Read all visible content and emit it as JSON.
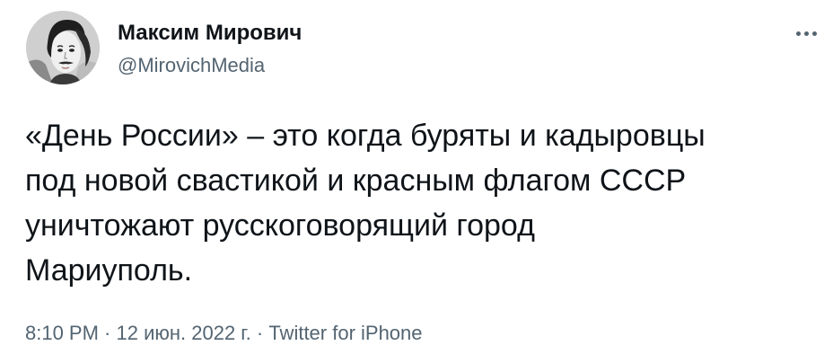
{
  "author": {
    "display_name": "Максим Мирович",
    "handle": "@MirovichMedia",
    "avatar_icon": "profile-photo"
  },
  "more_icon": "more-horizontal-icon",
  "tweet": {
    "lines": [
      "«День России» – это когда буряты и кадыровцы",
      "под новой свастикой и красным флагом СССР",
      "уничтожают русскоговорящий город",
      "Мариуполь."
    ]
  },
  "meta": {
    "time": "8:10 PM",
    "separator1": " · ",
    "date": "12 июн. 2022 г.",
    "separator2": " · ",
    "source": "Twitter for iPhone"
  },
  "colors": {
    "text_primary": "#0f1419",
    "text_secondary": "#536471",
    "background": "#ffffff"
  }
}
